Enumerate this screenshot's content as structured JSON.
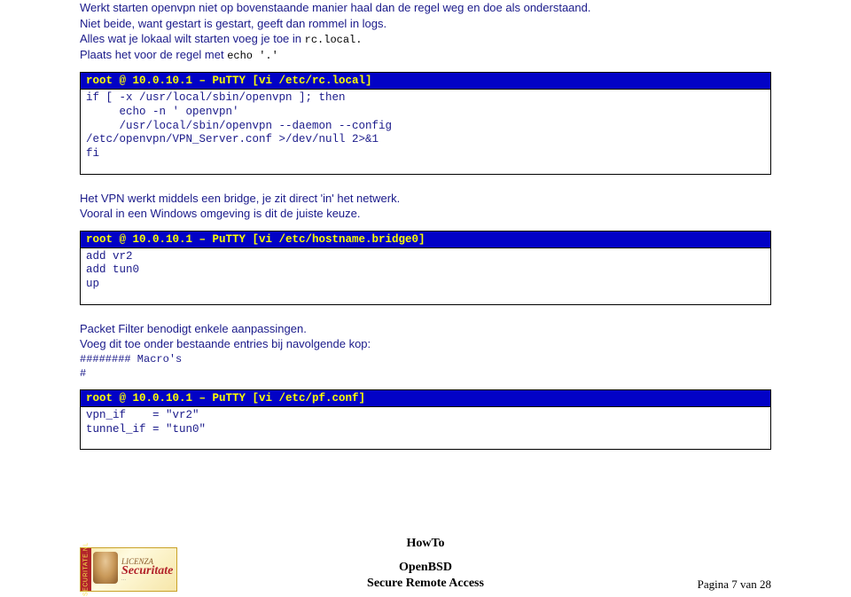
{
  "para1_a": "Werkt starten openvpn niet op bovenstaande manier haal dan de regel weg en doe als onderstaand.",
  "para1_b": "Niet beide, want gestart is gestart, geeft dan rommel in logs.",
  "para1_c_pre": "Alles wat je lokaal wilt starten voeg je toe in ",
  "para1_c_code": "rc.local.",
  "para1_d_pre": "Plaats het voor de regel met ",
  "para1_d_code": "echo '.'",
  "block1": {
    "title": "root @ 10.0.10.1 – PuTTY [vi /etc/rc.local]",
    "body": "if [ -x /usr/local/sbin/openvpn ]; then\n     echo -n ' openvpn'\n     /usr/local/sbin/openvpn --daemon --config\n/etc/openvpn/VPN_Server.conf >/dev/null 2>&1\nfi"
  },
  "para2_a": "Het VPN werkt middels een bridge, je zit direct 'in' het netwerk.",
  "para2_b": "Vooral in een Windows omgeving is dit de juiste keuze.",
  "block2": {
    "title": "root @ 10.0.10.1 – PuTTY [vi /etc/hostname.bridge0]",
    "body": "add vr2\nadd tun0\nup"
  },
  "para3_a": "Packet Filter benodigt enkele aanpassingen.",
  "para3_b": "Voeg dit toe onder bestaande entries bij navolgende kop:",
  "para3_code": "######## Macro's\n#",
  "block3": {
    "title": "root @ 10.0.10.1 – PuTTY [vi /etc/pf.conf]",
    "body": "vpn_if    = \"vr2\"\ntunnel_if = \"tun0\""
  },
  "footer": {
    "howto": "HowTo",
    "title1": "OpenBSD",
    "title2": "Secure Remote Access",
    "page": "Pagina 7 van 28",
    "stamp_side": "SECURITATE.NL",
    "stamp_lic": "LICENZA",
    "stamp_sec": "Securitate"
  }
}
